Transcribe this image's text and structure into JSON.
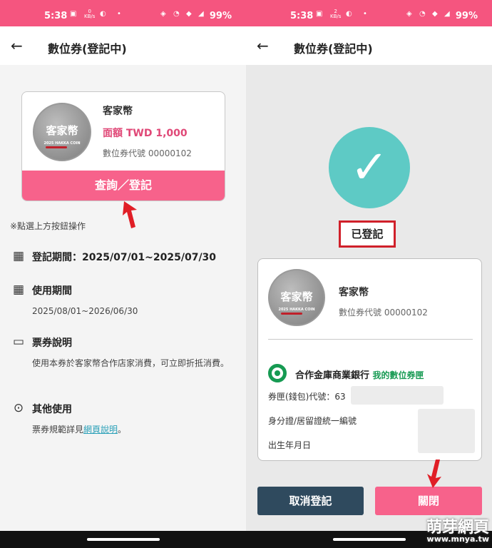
{
  "status": {
    "time": "5:38",
    "kb_value": "0",
    "kb_value_right": "2",
    "kb_unit": "KB/s",
    "battery": "99%"
  },
  "header": {
    "title": "數位券(登記中)"
  },
  "voucher": {
    "coin_text": "客家幣",
    "coin_caption": "2025 HAKKA COIN",
    "name": "客家幣",
    "face_value": "面額 TWD 1,000",
    "serial": "數位券代號 00000102",
    "action_label": "查詢／登記"
  },
  "hint": "※點選上方按鈕操作",
  "sections": {
    "register": {
      "label": "登記期間：2025/07/01~2025/07/30"
    },
    "use": {
      "label": "使用期間",
      "value": "2025/08/01~2026/06/30"
    },
    "desc": {
      "label": "票券說明",
      "value": "使用本券於客家幣合作店家消費，可立即折抵消費。"
    },
    "other": {
      "label": "其他使用",
      "value_prefix": "票券規範詳見",
      "link": "網頁說明",
      "value_suffix": "。"
    }
  },
  "result": {
    "status_label": "已登記",
    "name": "客家幣",
    "serial": "數位券代號 00000102",
    "bank_name": "合作金庫商業銀行",
    "bank_sub": "我的數位券匣",
    "wallet_label": "券匣(錢包)代號：63",
    "id_label": "身分證/居留證統一編號",
    "birth_label": "出生年月日",
    "cancel_label": "取消登記",
    "close_label": "關閉"
  },
  "watermark": {
    "title": "萌芽網頁",
    "url": "www.mnya.tw"
  },
  "colors": {
    "status_bar": "#f5557f",
    "accent": "#f7628b",
    "success": "#5ecac5",
    "dark_button": "#2f4a5e",
    "bank_green": "#169a52"
  }
}
